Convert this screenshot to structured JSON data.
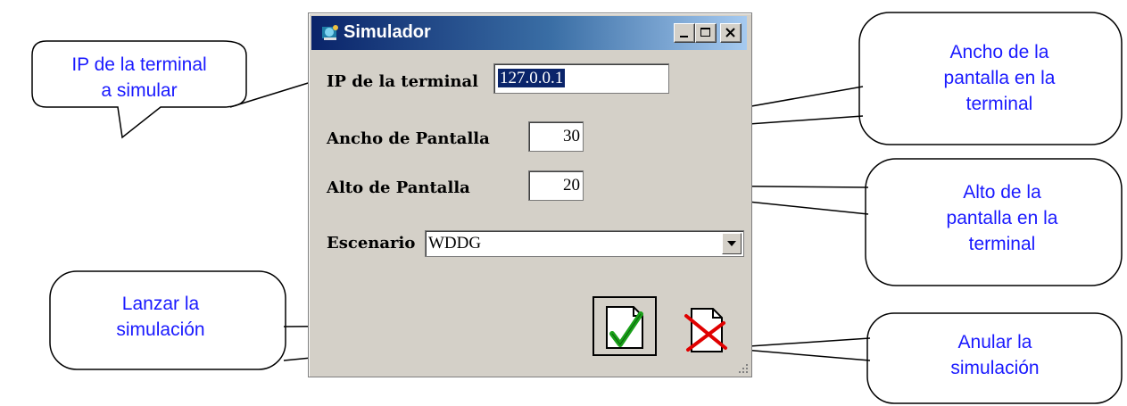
{
  "window": {
    "title": "Simulador"
  },
  "form": {
    "ip_label": "IP de la terminal",
    "ip_value": "127.0.0.1",
    "width_label": "Ancho de Pantalla",
    "width_value": "30",
    "height_label": "Alto de Pantalla",
    "height_value": "20",
    "scenario_label": "Escenario",
    "scenario_value": "WDDG"
  },
  "buttons": {
    "launch_icon": "document-check-icon",
    "cancel_icon": "document-x-icon"
  },
  "callouts": {
    "ip": "IP de la terminal\na simular",
    "width": "Ancho de la\npantalla en la\nterminal",
    "height": "Alto de la\npantalla en la\nterminal",
    "launch": "Lanzar la\nsimulación",
    "cancel": "Anular la\nsimulación"
  },
  "colors": {
    "callout_text": "#1a1aff",
    "titlebar_start": "#0a246a",
    "titlebar_end": "#a6caf0",
    "check_green": "#1aa01a",
    "cross_red": "#e00000"
  }
}
